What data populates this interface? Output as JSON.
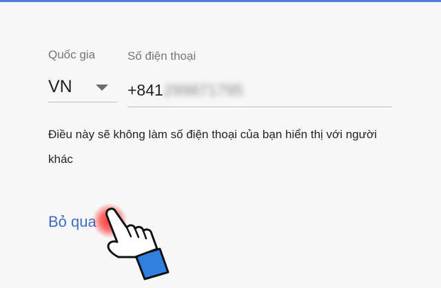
{
  "form": {
    "country_label": "Quốc gia",
    "country_value": "VN",
    "phone_label": "Số điện thoại",
    "phone_prefix": "+841",
    "phone_hidden": "299871795"
  },
  "notice": "Điều này sẽ không làm số điện thoại của bạn hiển thị với người khác",
  "skip_label": "Bỏ qua",
  "icons": {
    "dropdown": "caret-down-icon",
    "pointer": "hand-pointer-icon"
  },
  "colors": {
    "accent": "#3b6cc7",
    "tap_highlight": "#ff2828",
    "hand_cuff": "#2f80e0"
  }
}
